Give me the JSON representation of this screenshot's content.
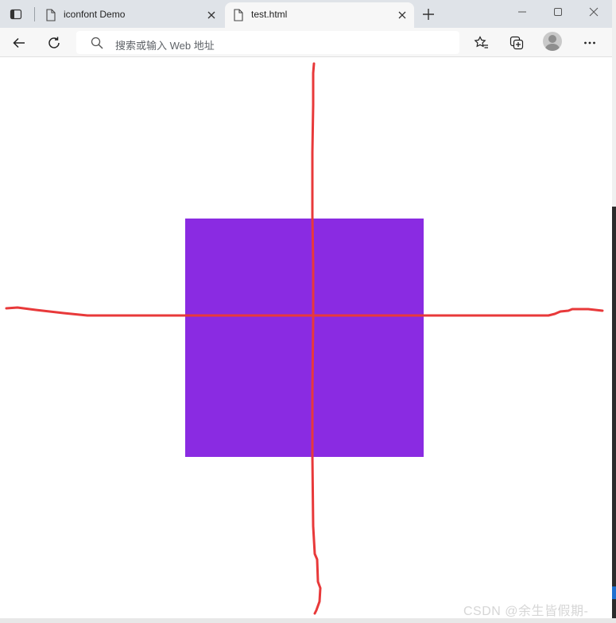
{
  "browser": {
    "tabs": [
      {
        "title": "iconfont Demo",
        "active": false
      },
      {
        "title": "test.html",
        "active": true
      }
    ],
    "address_placeholder": "搜索或输入 Web 地址",
    "icons": {
      "tab_actions": "tab-actions-icon",
      "page": "document-icon",
      "close": "close-icon",
      "new_tab": "plus-icon",
      "minimize": "minimize-icon",
      "maximize": "maximize-icon",
      "window_close": "window-close-icon",
      "back": "back-arrow-icon",
      "refresh": "refresh-icon",
      "search": "search-icon",
      "favorites": "favorites-icon",
      "collections": "collections-icon",
      "profile": "profile-avatar",
      "more": "more-icon"
    }
  },
  "page": {
    "box_color": "#8a2be2",
    "annotation_color": "#e8393a"
  },
  "watermark": "CSDN @余生皆假期-"
}
